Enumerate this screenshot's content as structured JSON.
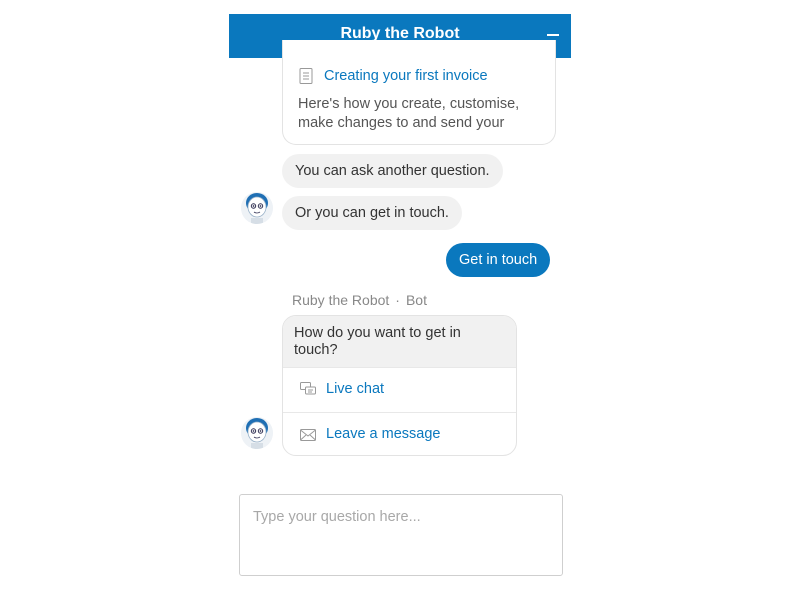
{
  "header": {
    "title": "Ruby the Robot"
  },
  "article": {
    "title": "Creating your first invoice",
    "excerpt": "Here's how you create, customise, make changes to and send your"
  },
  "messages": {
    "bot_1": "You can ask another question.",
    "bot_2": "Or you can get in touch.",
    "user_1": "Get in touch"
  },
  "sender": {
    "name": "Ruby the Robot",
    "separator": "·",
    "role": "Bot"
  },
  "contact_card": {
    "question": "How do you want to get in touch?",
    "options": [
      {
        "label": "Live chat",
        "icon": "chat-icon"
      },
      {
        "label": "Leave a message",
        "icon": "envelope-icon"
      }
    ]
  },
  "input": {
    "placeholder": "Type your question here..."
  },
  "colors": {
    "brand": "#0a78be",
    "bubble": "#f1f1f1"
  }
}
